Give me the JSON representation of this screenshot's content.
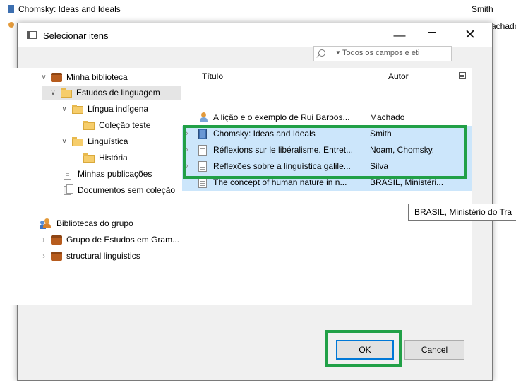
{
  "background": {
    "rows": [
      {
        "title": "Chomsky: Ideas and Ideals",
        "author": "Smith"
      },
      {
        "title": "",
        "author": "Machado"
      }
    ]
  },
  "dialog": {
    "title": "Selecionar itens",
    "search_placeholder": "Todos os campos e eti",
    "tree": {
      "library": "Minha biblioteca",
      "study_collection": "Estudos de linguagem",
      "indigenous": "Língua indígena",
      "test_collection": "Coleção teste",
      "linguistics": "Linguística",
      "history": "História",
      "my_publications": "Minhas publicações",
      "unfiled": "Documentos sem coleção",
      "group_libraries": "Bibliotecas do grupo",
      "group1": "Grupo de Estudos em Gram...",
      "group2": "structural linguistics"
    },
    "columns": {
      "title": "Título",
      "author": "Autor"
    },
    "items": [
      {
        "title": "A lição e o exemplo de Rui Barbos...",
        "author": "Machado"
      },
      {
        "title": "Chomsky: Ideas and Ideals",
        "author": "Smith"
      },
      {
        "title": "Réflexions sur le libéralisme. Entret...",
        "author": "Noam, Chomsky."
      },
      {
        "title": "Reflexões sobre a linguística galile...",
        "author": "Silva"
      },
      {
        "title": "The concept of human nature in n...",
        "author": "BRASIL, Ministéri..."
      }
    ],
    "tooltip": "BRASIL, Ministério do Tra",
    "buttons": {
      "ok": "OK",
      "cancel": "Cancel"
    }
  },
  "colors": {
    "highlight": "#cce6fb",
    "annotation": "#21a047",
    "accent": "#0078d7"
  }
}
